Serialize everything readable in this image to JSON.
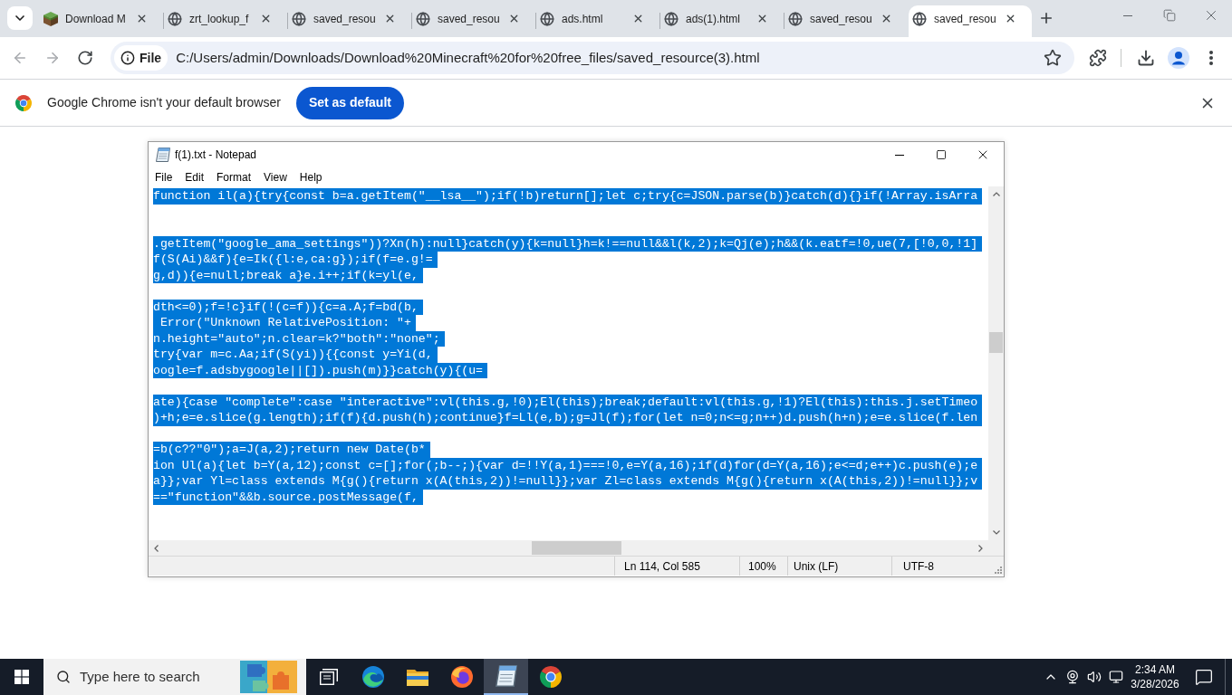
{
  "browser": {
    "tabs": [
      {
        "title": "Download M",
        "kind": "cube",
        "selected": false
      },
      {
        "title": "zrt_lookup_f",
        "kind": "globe",
        "selected": false
      },
      {
        "title": "saved_resou",
        "kind": "globe",
        "selected": false
      },
      {
        "title": "saved_resou",
        "kind": "globe",
        "selected": false
      },
      {
        "title": "ads.html",
        "kind": "globe",
        "selected": false
      },
      {
        "title": "ads(1).html",
        "kind": "globe",
        "selected": false
      },
      {
        "title": "saved_resou",
        "kind": "globe",
        "selected": false
      },
      {
        "title": "saved_resou",
        "kind": "globe",
        "selected": true
      }
    ],
    "navigation": [
      {
        "kind": "back",
        "disabled": true
      },
      {
        "kind": "forward",
        "disabled": true
      },
      {
        "kind": "reload",
        "disabled": false
      }
    ],
    "address_bar": {
      "scheme_chip": "File",
      "url": "C:/Users/admin/Downloads/Download%20Minecraft%20for%20free_files/saved_resource(3).html"
    },
    "infobar": {
      "message": "Google Chrome isn't your default browser",
      "button": "Set as default"
    }
  },
  "notepad": {
    "title": "f(1).txt - Notepad",
    "menu": [
      "File",
      "Edit",
      "Format",
      "View",
      "Help"
    ],
    "lines": [
      {
        "kind": "text",
        "text": "function il(a){try{const b=a.getItem(\"__lsa__\");if(!b)return[];let c;try{c=JSON.parse(b)}catch(d){}if(!Array.isArra",
        "selected": true
      },
      {
        "kind": "blank"
      },
      {
        "kind": "blank"
      },
      {
        "kind": "text",
        "text": ".getItem(\"google_ama_settings\"))?Xn(h):null}catch(y){k=null}h=k!==null&&l(k,2);k=Qj(e);h&&(k.eatf=!0,ue(7,[!0,0,!1]",
        "selected": true
      },
      {
        "kind": "text",
        "text": "f(S(Ai)&&f){e=Ik({l:e,ca:g});if(f=e.g!=",
        "selected": true
      },
      {
        "kind": "text",
        "text": "g,d)){e=null;break a}e.i++;if(k=yl(e,",
        "selected": true
      },
      {
        "kind": "blank"
      },
      {
        "kind": "text",
        "text": "dth<=0);f=!c}if(!(c=f)){c=a.A;f=bd(b,",
        "selected": true
      },
      {
        "kind": "text",
        "text": " Error(\"Unknown RelativePosition: \"+",
        "selected": true
      },
      {
        "kind": "text",
        "text": "n.height=\"auto\";n.clear=k?\"both\":\"none\";",
        "selected": true
      },
      {
        "kind": "text",
        "text": "try{var m=c.Aa;if(S(yi)){{const y=Yi(d,",
        "selected": true
      },
      {
        "kind": "text",
        "text": "oogle=f.adsbygoogle||[]).push(m)}}catch(y){(u=",
        "selected": true
      },
      {
        "kind": "blank"
      },
      {
        "kind": "text",
        "text": "ate){case \"complete\":case \"interactive\":vl(this.g,!0);El(this);break;default:vl(this.g,!1)?El(this):this.j.setTimeo",
        "selected": true
      },
      {
        "kind": "text",
        "text": ")+h;e=e.slice(g.length);if(f){d.push(h);continue}f=Ll(e,b);g=Jl(f);for(let n=0;n<=g;n++)d.push(h+n);e=e.slice(f.len",
        "selected": true
      },
      {
        "kind": "blank"
      },
      {
        "kind": "text",
        "text": "=b(c??\"0\");a=J(a,2);return new Date(b*",
        "selected": true
      },
      {
        "kind": "text",
        "text": "ion Ul(a){let b=Y(a,12);const c=[];for(;b--;){var d=!!Y(a,1)===!0,e=Y(a,16);if(d)for(d=Y(a,16);e<=d;e++)c.push(e);e",
        "selected": true
      },
      {
        "kind": "text",
        "text": "a}};var Yl=class extends M{g(){return x(A(this,2))!=null}};var Zl=class extends M{g(){return x(A(this,2))!=null}};v",
        "selected": true
      },
      {
        "kind": "text",
        "text": "==\"function\"&&b.source.postMessage(f,",
        "selected": true
      },
      {
        "kind": "blank"
      },
      {
        "kind": "blank"
      }
    ],
    "status_bar": {
      "position": "Ln 114, Col 585",
      "zoom": "100%",
      "line_ending": "Unix (LF)",
      "encoding": "UTF-8"
    }
  },
  "taskbar": {
    "search_placeholder": "Type here to search",
    "apps": [
      {
        "kind": "task_view",
        "selected": false
      },
      {
        "kind": "edge",
        "selected": false
      },
      {
        "kind": "file_explorer",
        "selected": false
      },
      {
        "kind": "firefox",
        "selected": false
      },
      {
        "kind": "notepad",
        "selected": true
      },
      {
        "kind": "chrome",
        "selected": false
      }
    ],
    "time": "2:34 AM",
    "date": "3/28/2026"
  }
}
